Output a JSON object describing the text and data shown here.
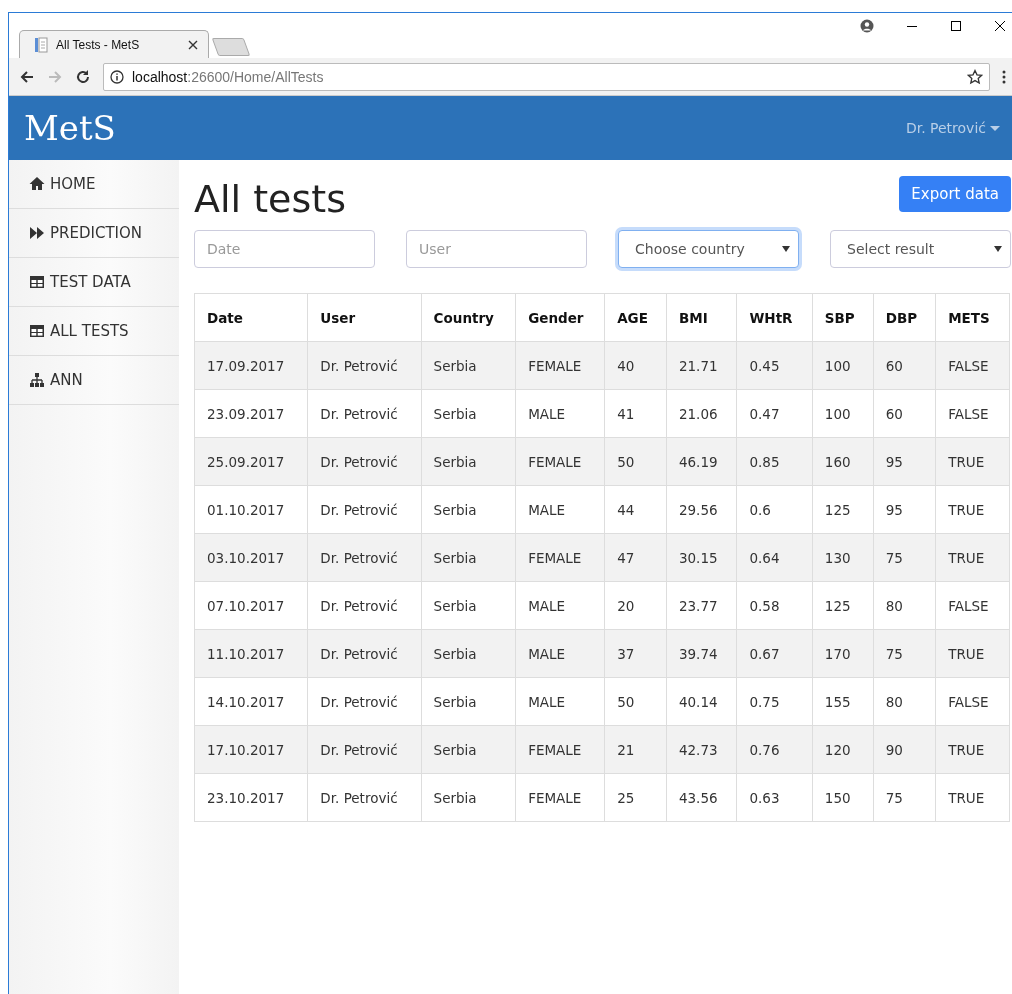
{
  "browser": {
    "tab_title": "All Tests - MetS",
    "url_host": "localhost",
    "url_path": ":26600/Home/AllTests"
  },
  "header": {
    "brand": "MetS",
    "user_menu": "Dr. Petrović"
  },
  "sidebar": {
    "items": [
      {
        "label": "HOME",
        "kind": "home"
      },
      {
        "label": "PREDICTION",
        "kind": "forward"
      },
      {
        "label": "TEST DATA",
        "kind": "table"
      },
      {
        "label": "ALL TESTS",
        "kind": "table"
      },
      {
        "label": "ANN",
        "kind": "tree"
      }
    ]
  },
  "page": {
    "title": "All tests",
    "export_button": "Export data"
  },
  "filters": [
    {
      "kind": "text",
      "placeholder": "Date",
      "focused": false
    },
    {
      "kind": "text",
      "placeholder": "User",
      "focused": false
    },
    {
      "kind": "select",
      "value": "Choose country",
      "focused": true
    },
    {
      "kind": "select",
      "value": "Select result",
      "focused": false
    }
  ],
  "table": {
    "columns": [
      "Date",
      "User",
      "Country",
      "Gender",
      "AGE",
      "BMI",
      "WHtR",
      "SBP",
      "DBP",
      "METS"
    ],
    "rows": [
      [
        "17.09.2017",
        "Dr. Petrović",
        "Serbia",
        "FEMALE",
        "40",
        "21.71",
        "0.45",
        "100",
        "60",
        "FALSE"
      ],
      [
        "23.09.2017",
        "Dr. Petrović",
        "Serbia",
        "MALE",
        "41",
        "21.06",
        "0.47",
        "100",
        "60",
        "FALSE"
      ],
      [
        "25.09.2017",
        "Dr. Petrović",
        "Serbia",
        "FEMALE",
        "50",
        "46.19",
        "0.85",
        "160",
        "95",
        "TRUE"
      ],
      [
        "01.10.2017",
        "Dr. Petrović",
        "Serbia",
        "MALE",
        "44",
        "29.56",
        "0.6",
        "125",
        "95",
        "TRUE"
      ],
      [
        "03.10.2017",
        "Dr. Petrović",
        "Serbia",
        "FEMALE",
        "47",
        "30.15",
        "0.64",
        "130",
        "75",
        "TRUE"
      ],
      [
        "07.10.2017",
        "Dr. Petrović",
        "Serbia",
        "MALE",
        "20",
        "23.77",
        "0.58",
        "125",
        "80",
        "FALSE"
      ],
      [
        "11.10.2017",
        "Dr. Petrović",
        "Serbia",
        "MALE",
        "37",
        "39.74",
        "0.67",
        "170",
        "75",
        "TRUE"
      ],
      [
        "14.10.2017",
        "Dr. Petrović",
        "Serbia",
        "MALE",
        "50",
        "40.14",
        "0.75",
        "155",
        "80",
        "FALSE"
      ],
      [
        "17.10.2017",
        "Dr. Petrović",
        "Serbia",
        "FEMALE",
        "21",
        "42.73",
        "0.76",
        "120",
        "90",
        "TRUE"
      ],
      [
        "23.10.2017",
        "Dr. Petrović",
        "Serbia",
        "FEMALE",
        "25",
        "43.56",
        "0.63",
        "150",
        "75",
        "TRUE"
      ]
    ]
  }
}
